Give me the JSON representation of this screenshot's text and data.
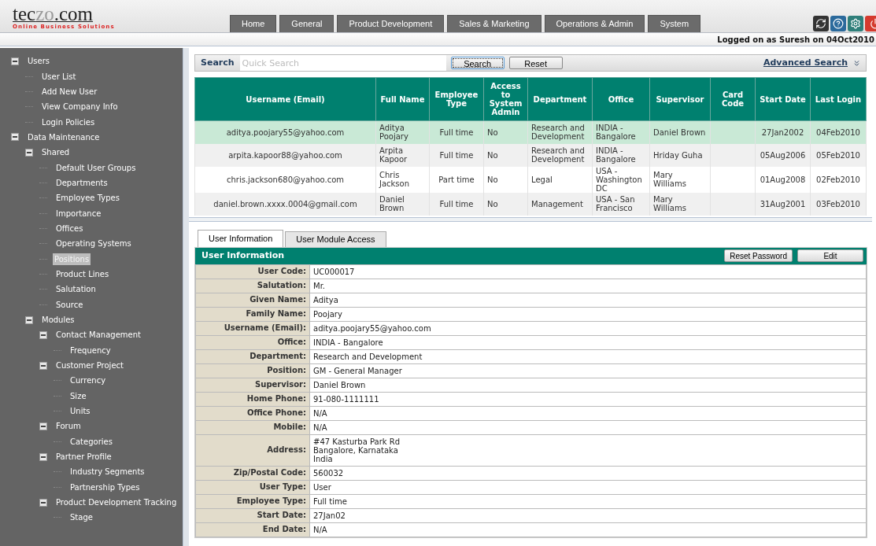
{
  "logo": {
    "parts": [
      {
        "text": "tec",
        "muted": false
      },
      {
        "text": "zo",
        "muted": true
      },
      {
        "text": ".com",
        "muted": false
      }
    ],
    "tagline": "Online Business Solutions"
  },
  "nav_tabs": [
    {
      "label": "Home"
    },
    {
      "label": "General"
    },
    {
      "label": "Product Development"
    },
    {
      "label": "Sales & Marketing"
    },
    {
      "label": "Operations & Admin"
    },
    {
      "label": "System"
    }
  ],
  "login_status": "Logged on as Suresh on 04Oct2010",
  "sidebar": {
    "tree": [
      {
        "label": "Users",
        "expanded": true,
        "selected": false,
        "children": [
          {
            "label": "User List",
            "selected": false
          },
          {
            "label": "Add New User",
            "selected": false
          },
          {
            "label": "View Company Info",
            "selected": false
          },
          {
            "label": "Login Policies",
            "selected": false
          }
        ]
      },
      {
        "label": "Data Maintenance",
        "expanded": true,
        "selected": false,
        "children": [
          {
            "label": "Shared",
            "expanded": true,
            "selected": false,
            "children": [
              {
                "label": "Default User Groups",
                "selected": false
              },
              {
                "label": "Departments",
                "selected": false
              },
              {
                "label": "Employee Types",
                "selected": false
              },
              {
                "label": "Importance",
                "selected": false
              },
              {
                "label": "Offices",
                "selected": false
              },
              {
                "label": "Operating Systems",
                "selected": false
              },
              {
                "label": "Positions",
                "selected": true
              },
              {
                "label": "Product Lines",
                "selected": false
              },
              {
                "label": "Salutation",
                "selected": false
              },
              {
                "label": "Source",
                "selected": false
              }
            ]
          },
          {
            "label": "Modules",
            "expanded": true,
            "selected": false,
            "children": [
              {
                "label": "Contact Management",
                "expanded": true,
                "selected": false,
                "children": [
                  {
                    "label": "Frequency",
                    "selected": false
                  }
                ]
              },
              {
                "label": "Customer Project",
                "expanded": true,
                "selected": false,
                "children": [
                  {
                    "label": "Currency",
                    "selected": false
                  },
                  {
                    "label": "Size",
                    "selected": false
                  },
                  {
                    "label": "Units",
                    "selected": false
                  }
                ]
              },
              {
                "label": "Forum",
                "expanded": true,
                "selected": false,
                "children": [
                  {
                    "label": "Categories",
                    "selected": false
                  }
                ]
              },
              {
                "label": "Partner Profile",
                "expanded": true,
                "selected": false,
                "children": [
                  {
                    "label": "Industry Segments",
                    "selected": false
                  },
                  {
                    "label": "Partnership Types",
                    "selected": false
                  }
                ]
              },
              {
                "label": "Product Development Tracking",
                "expanded": true,
                "selected": false,
                "children": [
                  {
                    "label": "Stage",
                    "selected": false
                  }
                ]
              }
            ]
          }
        ]
      }
    ]
  },
  "search": {
    "label": "Search",
    "placeholder": "Quick Search",
    "search_button": "Search",
    "reset_button": "Reset",
    "advanced_link": "Advanced Search"
  },
  "users_table": {
    "columns": [
      "Username (Email)",
      "Full Name",
      "Employee Type",
      "Access to System Admin",
      "Department",
      "Office",
      "Supervisor",
      "Card Code",
      "Start Date",
      "Last Login"
    ],
    "rows": [
      {
        "selected": true,
        "cells": [
          "aditya.poojary55@yahoo.com",
          "Aditya Poojary",
          "Full time",
          "No",
          "Research and Development",
          "INDIA - Bangalore",
          "Daniel Brown",
          "",
          "27Jan2002",
          "04Feb2010"
        ]
      },
      {
        "selected": false,
        "cells": [
          "arpita.kapoor88@yahoo.com",
          "Arpita Kapoor",
          "Full time",
          "No",
          "Research and Development",
          "INDIA - Bangalore",
          "Hriday Guha",
          "",
          "05Aug2006",
          "05Feb2010"
        ]
      },
      {
        "selected": false,
        "cells": [
          "chris.jackson680@yahoo.com",
          "Chris Jackson",
          "Part time",
          "No",
          "Legal",
          "USA - Washington DC",
          "Mary Williams",
          "",
          "01Aug2008",
          "02Feb2010"
        ]
      },
      {
        "selected": false,
        "cells": [
          "daniel.brown.xxxx.0004@gmail.com",
          "Daniel Brown",
          "Full time",
          "No",
          "Management",
          "USA - San Francisco",
          "Mary Williams",
          "",
          "31Aug2001",
          "03Feb2010"
        ]
      }
    ]
  },
  "detail_tabs": [
    {
      "label": "User Information",
      "selected": true
    },
    {
      "label": "User Module Access",
      "selected": false
    }
  ],
  "detail_panel": {
    "title": "User Information",
    "buttons": [
      "Reset Password",
      "Edit"
    ],
    "fields": [
      {
        "label": "User Code:",
        "value": "UC000017"
      },
      {
        "label": "Salutation:",
        "value": "Mr."
      },
      {
        "label": "Given Name:",
        "value": "Aditya"
      },
      {
        "label": "Family Name:",
        "value": "Poojary"
      },
      {
        "label": "Username (Email):",
        "value": "aditya.poojary55@yahoo.com"
      },
      {
        "label": "Office:",
        "value": "INDIA - Bangalore"
      },
      {
        "label": "Department:",
        "value": "Research and Development"
      },
      {
        "label": "Position:",
        "value": "GM - General Manager"
      },
      {
        "label": "Supervisor:",
        "value": "Daniel Brown"
      },
      {
        "label": "Home Phone:",
        "value": "91-080-1111111"
      },
      {
        "label": "Office Phone:",
        "value": "N/A"
      },
      {
        "label": "Mobile:",
        "value": "N/A"
      },
      {
        "label": "Address:",
        "value": "#47 Kasturba Park Rd\nBangalore, Karnataka\nIndia"
      },
      {
        "label": "Zip/Postal Code:",
        "value": "560032"
      },
      {
        "label": "User Type:",
        "value": "User"
      },
      {
        "label": "Employee Type:",
        "value": "Full time"
      },
      {
        "label": "Start Date:",
        "value": "27Jan02"
      },
      {
        "label": "End Date:",
        "value": "N/A"
      }
    ]
  }
}
